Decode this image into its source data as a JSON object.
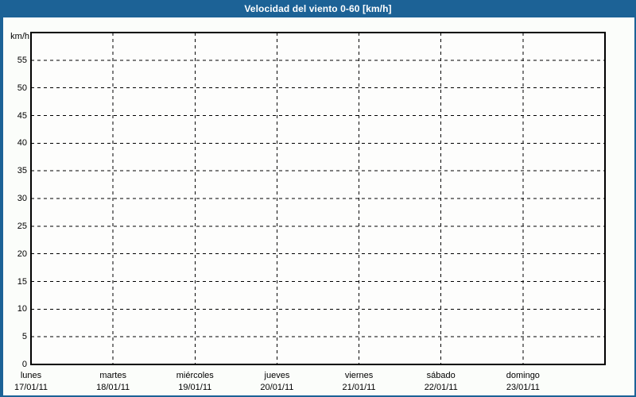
{
  "window": {
    "title": "Velocidad del viento 0-60 [km/h]"
  },
  "colors": {
    "frame": "#1c6296",
    "title_text": "#ffffff",
    "background": "#fbfdfa",
    "plot_background": "#fdfdfc",
    "axis": "#000000",
    "grid": "#000000",
    "label_text": "#000000"
  },
  "chart_data": {
    "type": "line",
    "title": "Velocidad del viento 0-60 [km/h]",
    "ylabel": "km/h",
    "ylim": [
      0,
      60
    ],
    "ytick_step": 5,
    "yticks": [
      0,
      5,
      10,
      15,
      20,
      25,
      30,
      35,
      40,
      45,
      50,
      55
    ],
    "grid": "dashed horizontal and vertical, black on white",
    "legend": "none",
    "categories": [
      "lunes",
      "martes",
      "miércoles",
      "jueves",
      "viernes",
      "sábado",
      "domingo"
    ],
    "category_dates": [
      "17/01/11",
      "18/01/11",
      "19/01/11",
      "20/01/11",
      "21/01/11",
      "22/01/11",
      "23/01/11"
    ],
    "series": []
  }
}
